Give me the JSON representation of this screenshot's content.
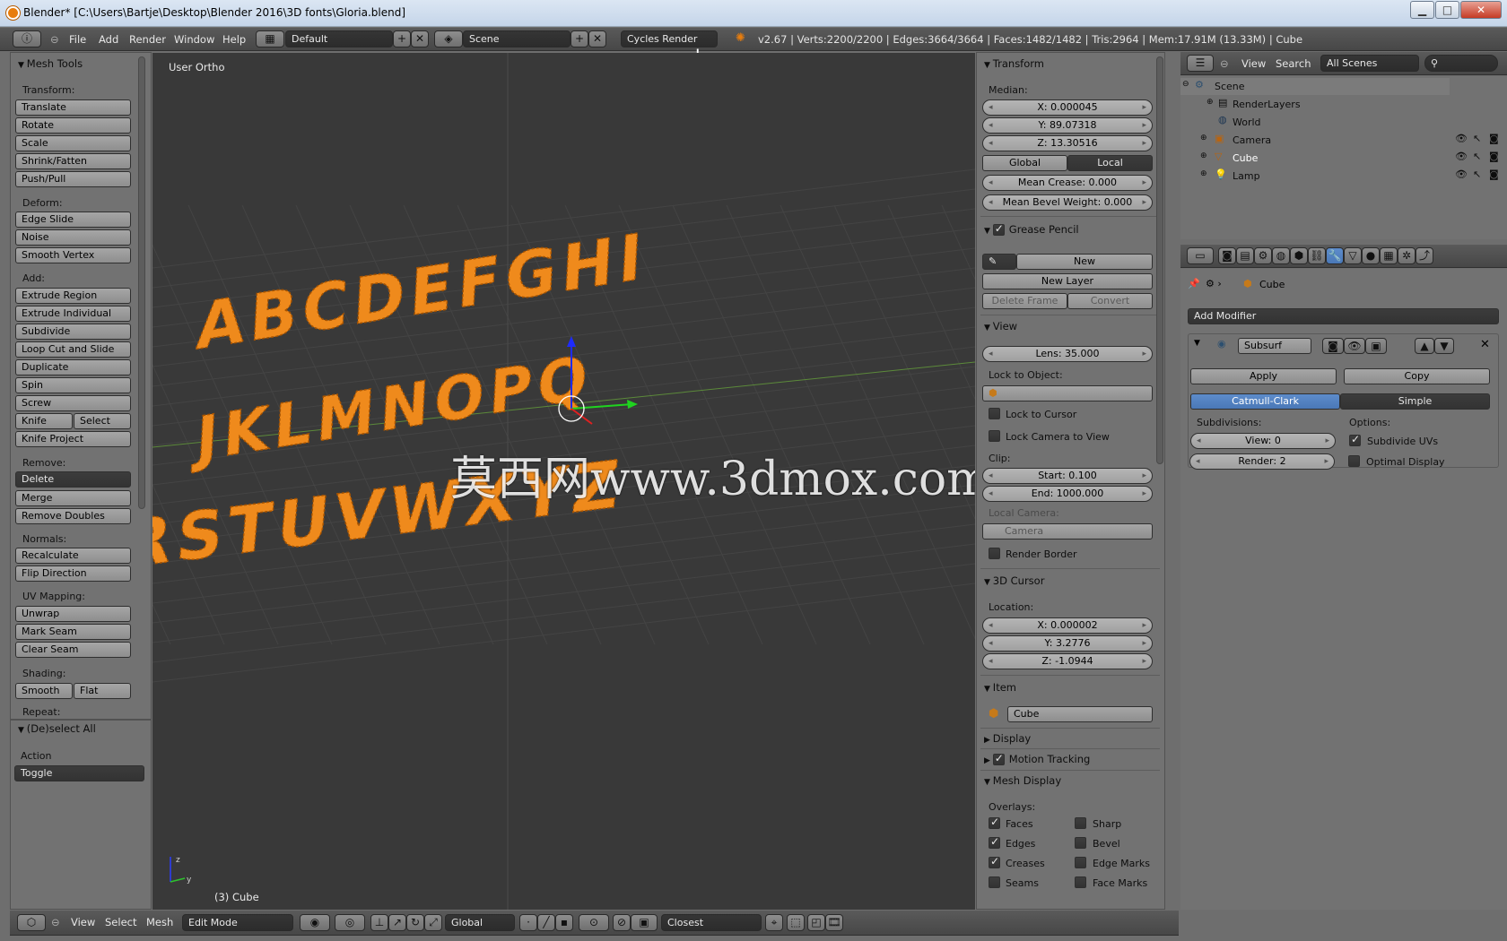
{
  "window": {
    "title": "Blender* [C:\\Users\\Bartje\\Desktop\\Blender 2016\\3D fonts\\Gloria.blend]",
    "min": "▁",
    "max": "□",
    "close": "✕"
  },
  "topbar": {
    "menus": [
      "File",
      "Add",
      "Render",
      "Window",
      "Help"
    ],
    "layout": "Default",
    "scene": "Scene",
    "engine": "Cycles Render",
    "stats": "v2.67 | Verts:2200/2200 | Edges:3664/3664 | Faces:1482/1482 | Tris:2964 | Mem:17.91M (13.33M) | Cube"
  },
  "tools": {
    "title": "Mesh Tools",
    "sections": [
      {
        "label": "Transform:",
        "buttons": [
          "Translate",
          "Rotate",
          "Scale",
          "Shrink/Fatten",
          "Push/Pull"
        ]
      },
      {
        "label": "Deform:",
        "buttons": [
          "Edge Slide",
          "Noise",
          "Smooth Vertex"
        ]
      },
      {
        "label": "Add:",
        "buttons": [
          "Extrude Region",
          "Extrude Individual",
          "Subdivide",
          "Loop Cut and Slide",
          "Duplicate",
          "Spin",
          "Screw"
        ]
      }
    ],
    "knife": "Knife",
    "select": "Select",
    "knife_project": "Knife Project",
    "remove_label": "Remove:",
    "delete": "Delete",
    "merge": "Merge",
    "remove_doubles": "Remove Doubles",
    "normals_label": "Normals:",
    "recalculate": "Recalculate",
    "flip": "Flip Direction",
    "uv_label": "UV Mapping:",
    "unwrap": "Unwrap",
    "mark_seam": "Mark Seam",
    "clear_seam": "Clear Seam",
    "shading_label": "Shading:",
    "smooth": "Smooth",
    "flat": "Flat",
    "repeat_label": "Repeat:",
    "op_title": "(De)select All",
    "action_label": "Action",
    "action_value": "Toggle"
  },
  "viewport": {
    "label": "User Ortho",
    "object": "(3) Cube",
    "watermark": "莫西网www.3dmox.com",
    "rows": [
      "ABCDEFGHI",
      "JKLMNOPQ",
      "RSTUVWXYZ"
    ]
  },
  "bottombar": {
    "menus": [
      "View",
      "Select",
      "Mesh"
    ],
    "mode": "Edit Mode",
    "orientation": "Global",
    "snap": "Closest"
  },
  "properties": {
    "transform_title": "Transform",
    "median": "Median:",
    "x": "X: 0.000045",
    "y": "Y: 89.07318",
    "z": "Z: 13.30516",
    "global": "Global",
    "local": "Local",
    "crease": "Mean Crease: 0.000",
    "bevel": "Mean Bevel Weight: 0.000",
    "gp_title": "Grease Pencil",
    "gp_new": "New",
    "gp_new_layer": "New Layer",
    "gp_delete_frame": "Delete Frame",
    "gp_convert": "Convert",
    "view_title": "View",
    "lens": "Lens: 35.000",
    "lock_obj": "Lock to Object:",
    "lock_cursor": "Lock to Cursor",
    "lock_cam": "Lock Camera to View",
    "clip": "Clip:",
    "clip_start": "Start: 0.100",
    "clip_end": "End: 1000.000",
    "local_camera": "Local Camera:",
    "camera": "Camera",
    "render_border": "Render Border",
    "cursor_title": "3D Cursor",
    "location": "Location:",
    "cx": "X: 0.000002",
    "cy": "Y: 3.2776",
    "cz": "Z: -1.0944",
    "item_title": "Item",
    "item_name": "Cube",
    "display_title": "Display",
    "motion_title": "Motion Tracking",
    "mesh_display_title": "Mesh Display",
    "overlays": "Overlays:",
    "ov_left": [
      "Faces",
      "Edges",
      "Creases",
      "Seams"
    ],
    "ov_right": [
      "Sharp",
      "Bevel",
      "Edge Marks",
      "Face Marks"
    ]
  },
  "outliner": {
    "view": "View",
    "search": "Search",
    "scenes": "All Scenes",
    "items": [
      "Scene",
      "RenderLayers",
      "World",
      "Camera",
      "Cube",
      "Lamp"
    ]
  },
  "modifiers": {
    "object": "Cube",
    "add": "Add Modifier",
    "name": "Subsurf",
    "apply": "Apply",
    "copy": "Copy",
    "catmull": "Catmull-Clark",
    "simple": "Simple",
    "subdivisions": "Subdivisions:",
    "options": "Options:",
    "view": "View: 0",
    "render": "Render: 2",
    "sub_uvs": "Subdivide UVs",
    "optimal": "Optimal Display"
  }
}
